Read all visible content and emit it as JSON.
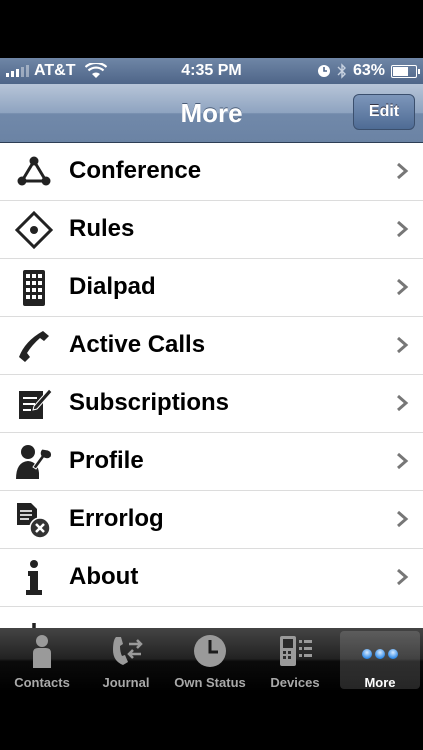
{
  "status_bar": {
    "carrier": "AT&T",
    "time": "4:35 PM",
    "battery": "63%",
    "battery_level": 0.63
  },
  "nav": {
    "title": "More",
    "edit_label": "Edit"
  },
  "menu": [
    {
      "label": "Conference",
      "icon": "conference-icon"
    },
    {
      "label": "Rules",
      "icon": "rules-icon"
    },
    {
      "label": "Dialpad",
      "icon": "dialpad-icon"
    },
    {
      "label": "Active Calls",
      "icon": "phone-icon"
    },
    {
      "label": "Subscriptions",
      "icon": "subscriptions-icon"
    },
    {
      "label": "Profile",
      "icon": "profile-icon"
    },
    {
      "label": "Errorlog",
      "icon": "errorlog-icon"
    },
    {
      "label": "About",
      "icon": "info-icon"
    },
    {
      "label": "",
      "icon": "power-icon"
    }
  ],
  "tabs": [
    {
      "label": "Contacts",
      "icon": "person-icon"
    },
    {
      "label": "Journal",
      "icon": "journal-icon"
    },
    {
      "label": "Own Status",
      "icon": "clock-icon"
    },
    {
      "label": "Devices",
      "icon": "devices-icon"
    },
    {
      "label": "More",
      "icon": "more-icon",
      "active": true
    }
  ]
}
